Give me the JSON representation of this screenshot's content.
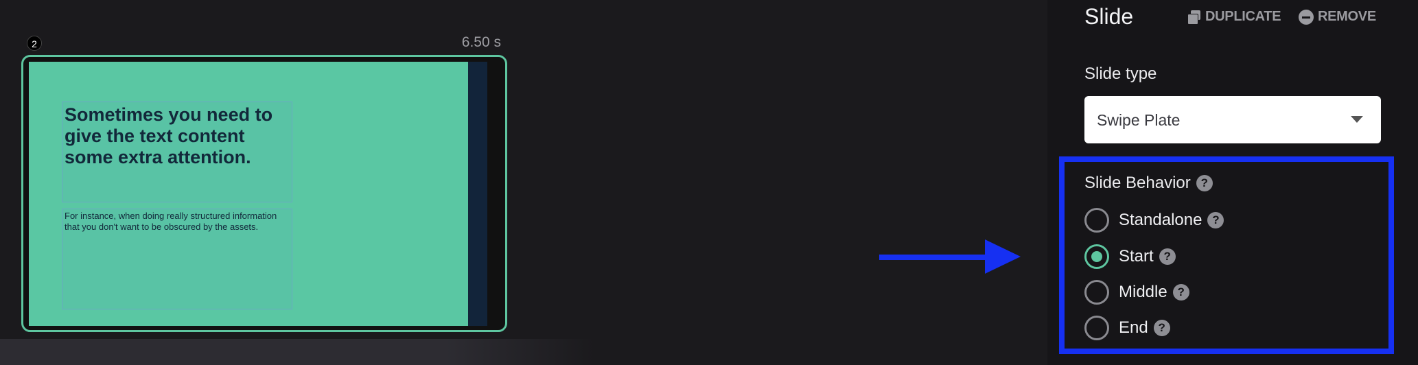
{
  "timeline": {
    "slide_number": "2",
    "duration": "6.50 s",
    "thumbnail": {
      "heading": "Sometimes you need to give the text content some extra attention.",
      "body": "For instance, when doing really structured information that you don't want to be obscured by the assets."
    }
  },
  "panel": {
    "title": "Slide",
    "duplicate_label": "DUPLICATE",
    "remove_label": "REMOVE",
    "slide_type_label": "Slide type",
    "slide_type_value": "Swipe Plate",
    "behavior_label": "Slide Behavior",
    "help_glyph": "?",
    "options": [
      {
        "label": "Standalone",
        "checked": false
      },
      {
        "label": "Start",
        "checked": true
      },
      {
        "label": "Middle",
        "checked": false
      },
      {
        "label": "End",
        "checked": false
      }
    ]
  },
  "colors": {
    "accent_green": "#5ec6a0",
    "highlight_blue": "#1630f2",
    "panel_bg": "#161518",
    "page_bg": "#1b1a1d"
  },
  "icons": {
    "duplicate": "duplicate-icon",
    "remove": "remove-circle-icon",
    "help": "help-circle-icon",
    "dropdown": "caret-down-icon",
    "arrow": "arrow-right-icon"
  }
}
